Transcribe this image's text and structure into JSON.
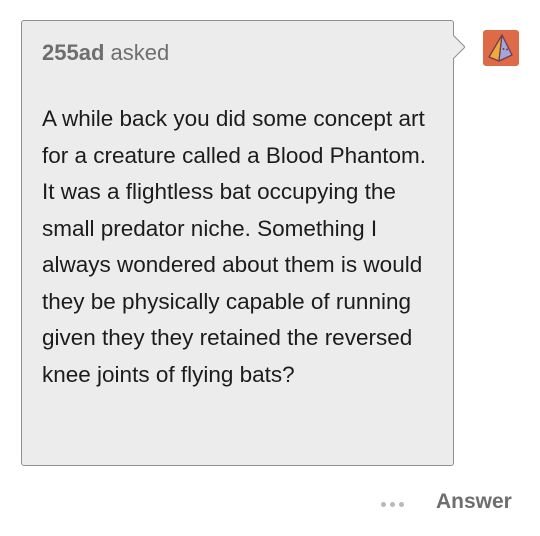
{
  "ask": {
    "asker_name": "255ad",
    "asked_label": "asked",
    "question": "A while back you did some concept art for a creature called a Blood Phantom. It was a flightless bat occupying the small predator niche. Something I always wondered about them is would they be physically capable of running given they they retained the reversed knee joints of flying bats?"
  },
  "avatar": {
    "icon": "pyramid-avatar-icon",
    "background_color": "#df6a47"
  },
  "footer": {
    "more_icon": "ellipsis-icon",
    "answer_label": "Answer"
  }
}
